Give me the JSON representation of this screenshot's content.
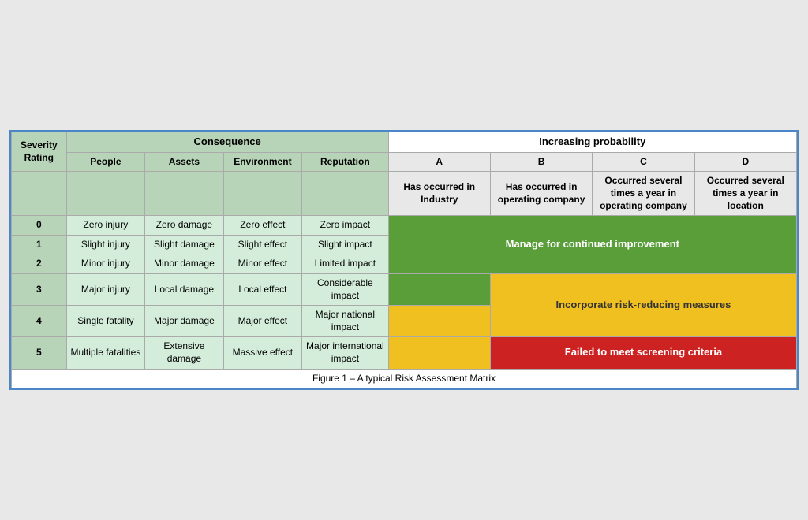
{
  "caption": "Figure 1 – A typical Risk Assessment Matrix",
  "headers": {
    "consequence": "Consequence",
    "increasing_probability": "Increasing probability",
    "severity_rating": "Severity Rating",
    "people": "People",
    "assets": "Assets",
    "environment": "Environment",
    "reputation": "Reputation",
    "col_a": "A",
    "col_b": "B",
    "col_c": "C",
    "col_d": "D",
    "desc_a": "Has occurred in Industry",
    "desc_b": "Has occurred in operating company",
    "desc_c": "Occurred several times a year in operating company",
    "desc_d": "Occurred several times a year in location"
  },
  "rows": [
    {
      "severity": "0",
      "people": "Zero injury",
      "assets": "Zero damage",
      "environment": "Zero effect",
      "reputation": "Zero impact"
    },
    {
      "severity": "1",
      "people": "Slight injury",
      "assets": "Slight damage",
      "environment": "Slight effect",
      "reputation": "Slight impact"
    },
    {
      "severity": "2",
      "people": "Minor injury",
      "assets": "Minor damage",
      "environment": "Minor effect",
      "reputation": "Limited impact"
    },
    {
      "severity": "3",
      "people": "Major injury",
      "assets": "Local damage",
      "environment": "Local effect",
      "reputation": "Considerable impact"
    },
    {
      "severity": "4",
      "people": "Single fatality",
      "assets": "Major damage",
      "environment": "Major effect",
      "reputation": "Major national impact"
    },
    {
      "severity": "5",
      "people": "Multiple fatalities",
      "assets": "Extensive damage",
      "environment": "Massive effect",
      "reputation": "Major international impact"
    }
  ],
  "risk_labels": {
    "green": "Manage for continued improvement",
    "yellow": "Incorporate risk-reducing measures",
    "red": "Failed to meet screening criteria"
  }
}
